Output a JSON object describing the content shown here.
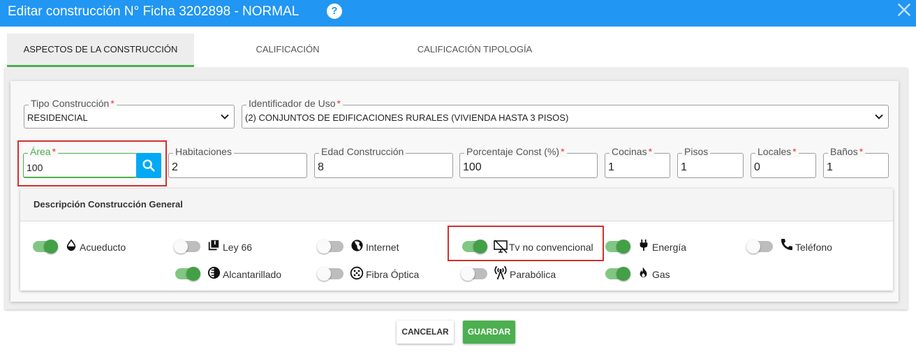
{
  "dialog": {
    "title": "Editar construcción N° Ficha 3202898 - NORMAL",
    "help_label": "?"
  },
  "tabs": [
    {
      "label": "ASPECTOS DE LA CONSTRUCCIÓN",
      "active": true
    },
    {
      "label": "CALIFICACIÓN",
      "active": false
    },
    {
      "label": "CALIFICACIÓN TIPOLOGÍA",
      "active": false
    }
  ],
  "form": {
    "tipo_construccion": {
      "label": "Tipo Construcción",
      "required": "*",
      "value": "RESIDENCIAL"
    },
    "identificador_uso": {
      "label": "Identificador de Uso",
      "required": "*",
      "value": "(2) CONJUNTOS DE EDIFICACIONES RURALES (VIVIENDA HASTA 3 PISOS)"
    },
    "area": {
      "label": "Área",
      "required": "*",
      "value": "100"
    },
    "habitaciones": {
      "label": "Habitaciones",
      "value": "2"
    },
    "edad_construccion": {
      "label": "Edad Construcción",
      "value": "8"
    },
    "porcentaje_const": {
      "label": "Porcentaje Const (%)",
      "required": "*",
      "value": "100"
    },
    "cocinas": {
      "label": "Cocinas",
      "required": "*",
      "value": "1"
    },
    "pisos": {
      "label": "Pisos",
      "value": "1"
    },
    "locales": {
      "label": "Locales",
      "required": "*",
      "value": "0"
    },
    "banos": {
      "label": "Baños",
      "required": "*",
      "value": "1"
    }
  },
  "description": {
    "title": "Descripción Construcción General",
    "services": [
      {
        "label": "Acueducto",
        "icon": "water-drop-icon",
        "on": true
      },
      {
        "label": "Ley 66",
        "icon": "library-icon",
        "on": false
      },
      {
        "label": "Internet",
        "icon": "globe-icon",
        "on": false
      },
      {
        "label": "Tv no convencional",
        "icon": "tv-off-icon",
        "on": true
      },
      {
        "label": "Energía",
        "icon": "plug-icon",
        "on": true
      },
      {
        "label": "Teléfono",
        "icon": "phone-icon",
        "on": false
      },
      {
        "label": "Alcantarillado",
        "icon": "contrast-icon",
        "on": true
      },
      {
        "label": "Fibra Óptica",
        "icon": "fiber-connector-icon",
        "on": false
      },
      {
        "label": "Parabólica",
        "icon": "antenna-icon",
        "on": false
      },
      {
        "label": "Gas",
        "icon": "flame-icon",
        "on": true
      }
    ]
  },
  "actions": {
    "cancel_label": "CANCELAR",
    "save_label": "GUARDAR"
  },
  "colors": {
    "header": "#2196f3",
    "accent_green": "#4caf50",
    "search_button": "#03a9f4",
    "required": "#e53935",
    "highlight": "#d32f2f"
  }
}
